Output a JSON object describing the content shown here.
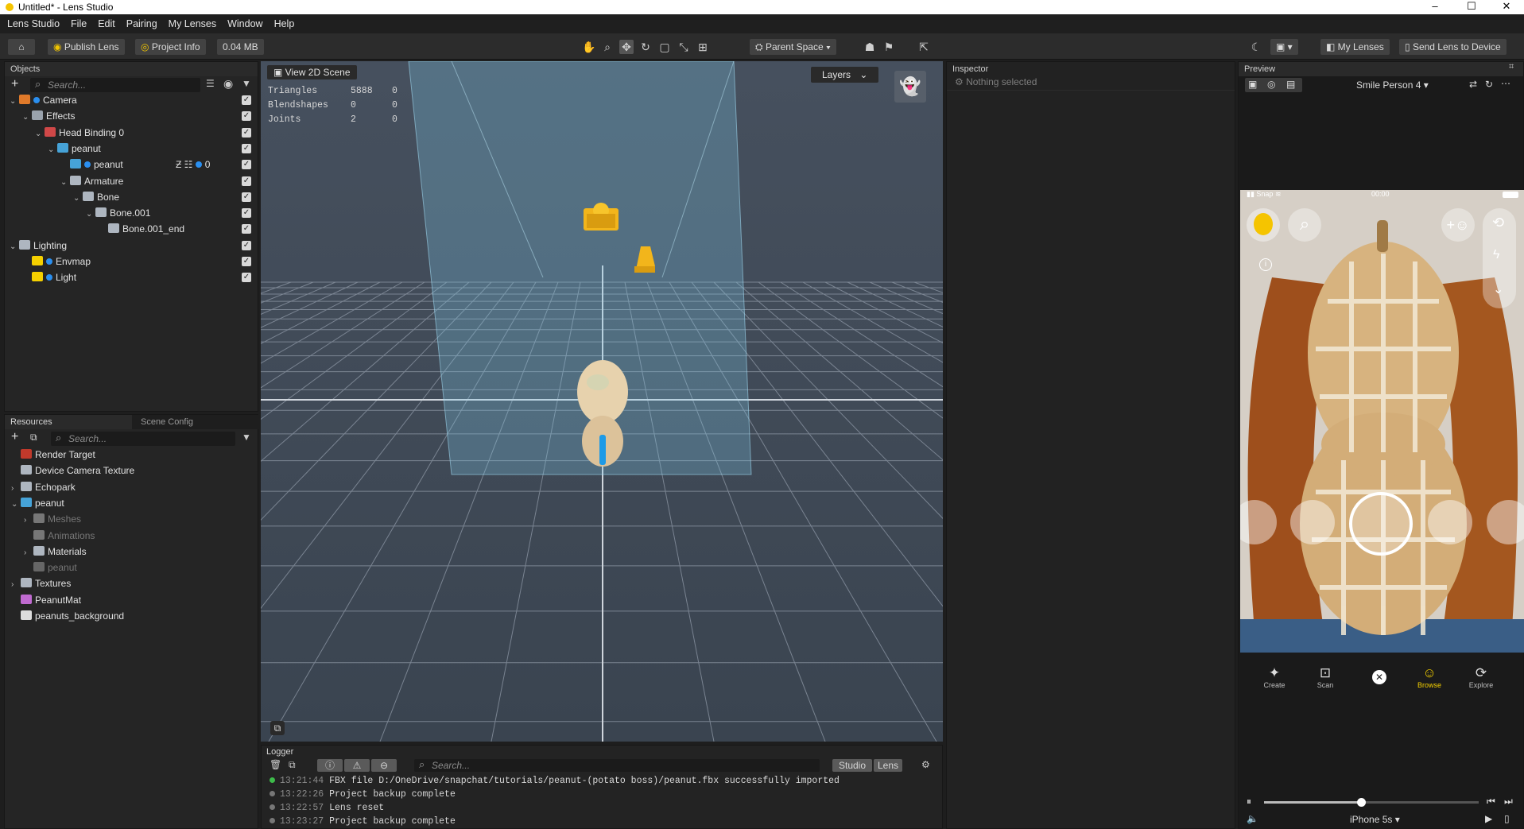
{
  "window": {
    "title": "Untitled* - Lens Studio",
    "controls": [
      "–",
      "☐",
      "✕"
    ]
  },
  "menu": [
    "Lens Studio",
    "File",
    "Edit",
    "Pairing",
    "My Lenses",
    "Window",
    "Help"
  ],
  "toolbar": {
    "publish": "Publish Lens",
    "project_info": "Project Info",
    "size": "0.04 MB",
    "space": "Parent Space",
    "my_lenses": "My Lenses",
    "send": "Send Lens to Device"
  },
  "objects": {
    "title": "Objects",
    "search_placeholder": "Search...",
    "tree": [
      {
        "label": "Camera",
        "indent": 0
      },
      {
        "label": "Effects",
        "indent": 1
      },
      {
        "label": "Head Binding 0",
        "indent": 2
      },
      {
        "label": "peanut",
        "indent": 3
      },
      {
        "label": "peanut",
        "indent": 4
      },
      {
        "label": "Armature",
        "indent": 4
      },
      {
        "label": "Bone",
        "indent": 5
      },
      {
        "label": "Bone.001",
        "indent": 6
      },
      {
        "label": "Bone.001_end",
        "indent": 7
      },
      {
        "label": "Lighting",
        "indent": 0
      },
      {
        "label": "Envmap",
        "indent": 1
      },
      {
        "label": "Light",
        "indent": 1
      }
    ],
    "peanut_layer": "0"
  },
  "resources": {
    "tab1": "Resources",
    "tab2": "Scene Config",
    "search_placeholder": "Search...",
    "items": [
      {
        "label": "Render Target"
      },
      {
        "label": "Device Camera Texture"
      },
      {
        "label": "Echopark"
      },
      {
        "label": "peanut"
      },
      {
        "label": "Meshes"
      },
      {
        "label": "Animations"
      },
      {
        "label": "Materials"
      },
      {
        "label": "peanut"
      },
      {
        "label": "Textures"
      },
      {
        "label": "PeanutMat"
      },
      {
        "label": "peanuts_background"
      }
    ]
  },
  "viewport": {
    "tab": "View 2D Scene",
    "layers": "Layers",
    "stats": [
      {
        "label": "Triangles",
        "a": "5888",
        "b": "0"
      },
      {
        "label": "Blendshapes",
        "a": "0",
        "b": "0"
      },
      {
        "label": "Joints",
        "a": "2",
        "b": "0"
      }
    ]
  },
  "logger": {
    "title": "Logger",
    "search_placeholder": "Search...",
    "studio": "Studio",
    "lens": "Lens",
    "lines": [
      {
        "time": "13:21:44",
        "text": "FBX file D:/OneDrive/snapchat/tutorials/peanut-(potato boss)/peanut.fbx successfully imported"
      },
      {
        "time": "13:22:26",
        "text": "Project backup complete"
      },
      {
        "time": "13:22:57",
        "text": "Lens reset"
      },
      {
        "time": "13:23:27",
        "text": "Project backup complete"
      }
    ]
  },
  "inspector": {
    "title": "Inspector",
    "empty": "Nothing selected"
  },
  "preview": {
    "title": "Preview",
    "person": "Smile Person 4",
    "device": "iPhone 5s",
    "status_carrier": "Snap",
    "status_time": "00:00",
    "nav": [
      "Create",
      "Scan",
      "Browse",
      "Explore"
    ],
    "playback_progress": 0.45
  }
}
